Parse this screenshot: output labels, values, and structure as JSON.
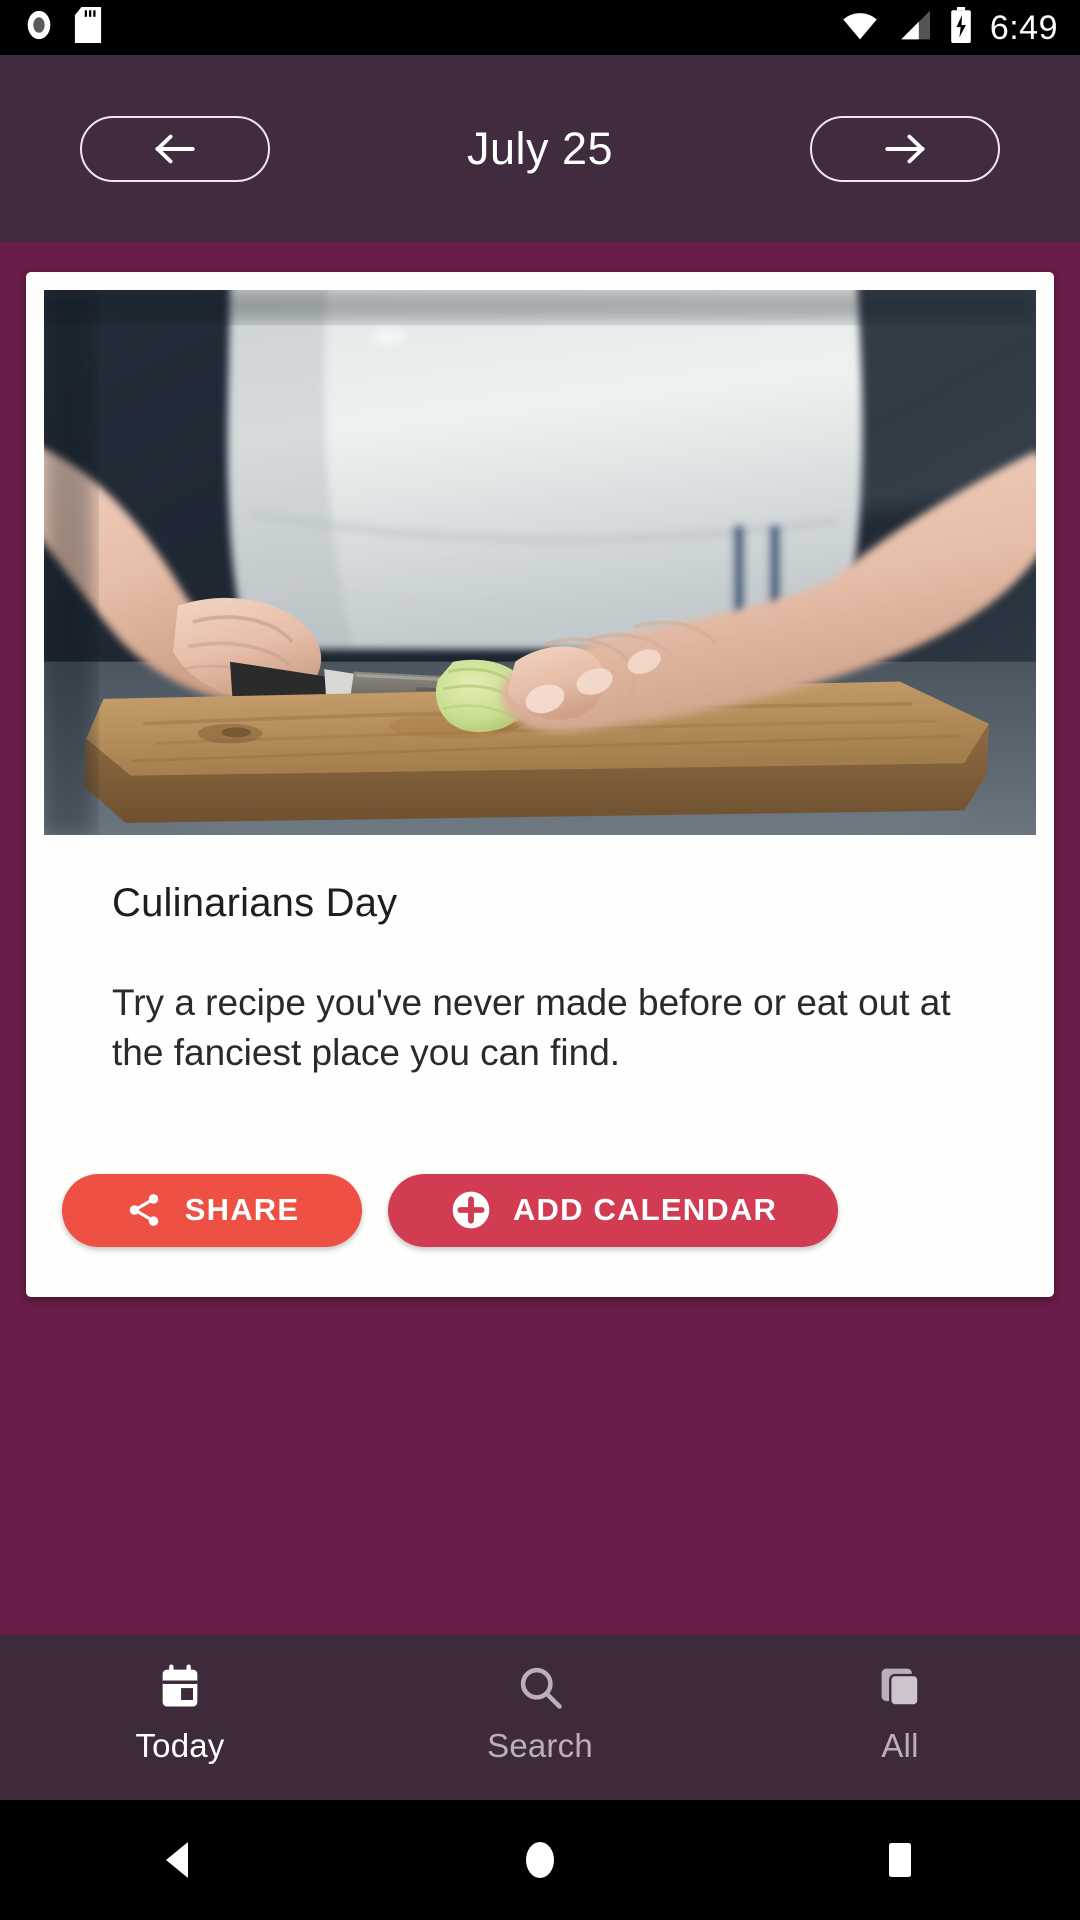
{
  "status_bar": {
    "time": "6:49",
    "icons": [
      "camera-icon",
      "sd-card-icon",
      "wifi-icon",
      "cell-signal-icon",
      "battery-charging-icon"
    ]
  },
  "header": {
    "title": "July 25",
    "prev_button_icon": "arrow-left-icon",
    "next_button_icon": "arrow-right-icon",
    "background_color": "#402C3E"
  },
  "page": {
    "background_color": "#6A1D48"
  },
  "card": {
    "image_alt": "person slicing vegetable with chef knife on wooden cutting board",
    "title": "Culinarians Day",
    "description": "Try a recipe you've never made before or eat out at the fanciest place you can find.",
    "background_color": "#FEFEFC"
  },
  "actions": {
    "share": {
      "label": "SHARE",
      "icon": "share-icon",
      "color": "#EE5043"
    },
    "add_calendar": {
      "label": "ADD CALENDAR",
      "icon": "plus-circle-icon",
      "color": "#D23C52"
    }
  },
  "bottom_nav": {
    "background_color": "#3D2B3C",
    "active_color": "#FFFFFF",
    "inactive_color": "#BCAEBB",
    "items": [
      {
        "label": "Today",
        "icon": "calendar-icon",
        "active": true
      },
      {
        "label": "Search",
        "icon": "search-icon",
        "active": false
      },
      {
        "label": "All",
        "icon": "layers-icon",
        "active": false
      }
    ]
  },
  "system_nav": {
    "back_icon": "triangle-back-icon",
    "home_icon": "circle-home-icon",
    "recents_icon": "square-recents-icon"
  }
}
